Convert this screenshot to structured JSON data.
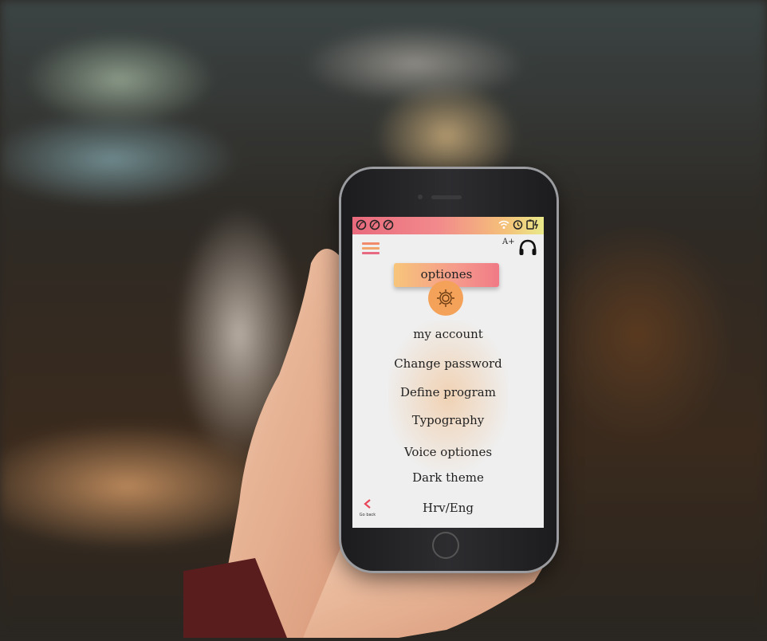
{
  "app": {
    "header": {
      "font_size_label": "A+",
      "accent_gradient": [
        "#e96a7d",
        "#f4c179",
        "#e9e98a"
      ]
    },
    "title": "optiones",
    "menu_items": [
      {
        "label": "my account"
      },
      {
        "label": "Change password"
      },
      {
        "label": "Define program"
      },
      {
        "label": "Typography"
      },
      {
        "label": "Voice optiones"
      },
      {
        "label": "Dark theme"
      },
      {
        "label": "Hrv/Eng"
      }
    ],
    "go_back_label": "Go back",
    "accent_color": "#f4a259",
    "back_color": "#e8475a"
  }
}
